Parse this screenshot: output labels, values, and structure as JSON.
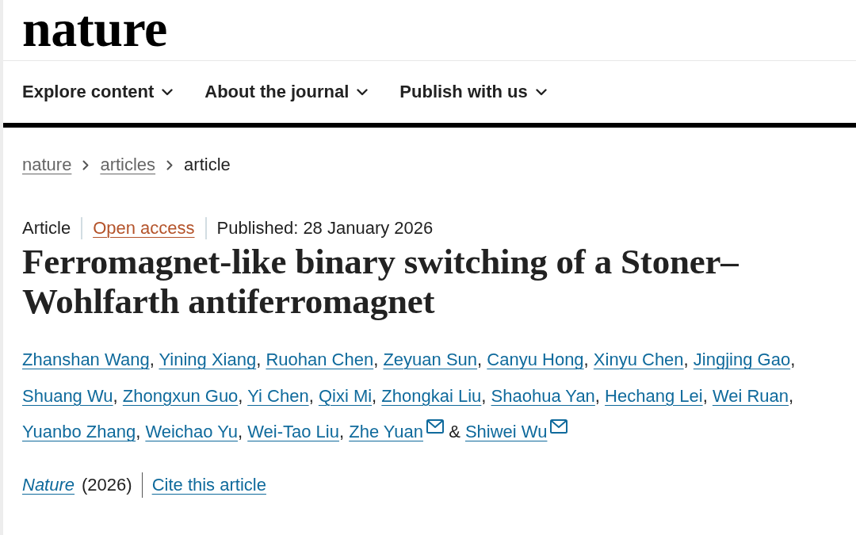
{
  "header": {
    "logo": "nature",
    "nav": [
      {
        "label": "Explore content"
      },
      {
        "label": "About the journal"
      },
      {
        "label": "Publish with us"
      }
    ]
  },
  "breadcrumb": [
    {
      "label": "nature",
      "current": false
    },
    {
      "label": "articles",
      "current": false
    },
    {
      "label": "article",
      "current": true
    }
  ],
  "article": {
    "type": "Article",
    "access": "Open access",
    "published": "Published: 28 January 2026",
    "title": "Ferromagnet-like binary switching of a Stoner–Wohlfarth antiferromagnet",
    "separator": ",",
    "final_separator": "&",
    "authors": [
      {
        "name": "Zhanshan Wang",
        "contact": false
      },
      {
        "name": "Yining Xiang",
        "contact": false
      },
      {
        "name": "Ruohan Chen",
        "contact": false
      },
      {
        "name": "Zeyuan Sun",
        "contact": false
      },
      {
        "name": "Canyu Hong",
        "contact": false
      },
      {
        "name": "Xinyu Chen",
        "contact": false
      },
      {
        "name": "Jingjing Gao",
        "contact": false
      },
      {
        "name": "Shuang Wu",
        "contact": false
      },
      {
        "name": "Zhongxun Guo",
        "contact": false
      },
      {
        "name": "Yi Chen",
        "contact": false
      },
      {
        "name": "Qixi Mi",
        "contact": false
      },
      {
        "name": "Zhongkai Liu",
        "contact": false
      },
      {
        "name": "Shaohua Yan",
        "contact": false
      },
      {
        "name": "Hechang Lei",
        "contact": false
      },
      {
        "name": "Wei Ruan",
        "contact": false
      },
      {
        "name": "Yuanbo Zhang",
        "contact": false
      },
      {
        "name": "Weichao Yu",
        "contact": false
      },
      {
        "name": "Wei-Tao Liu",
        "contact": false
      },
      {
        "name": "Zhe Yuan",
        "contact": true
      },
      {
        "name": "Shiwei Wu",
        "contact": true
      }
    ],
    "journal": "Nature",
    "year": "(2026)",
    "cite": "Cite this article"
  }
}
